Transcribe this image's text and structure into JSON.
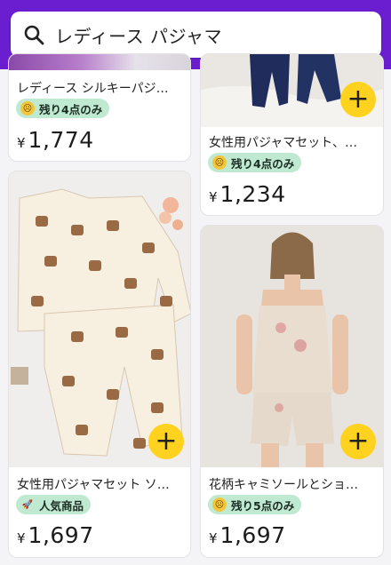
{
  "search": {
    "query": "レディース パジャマ",
    "icon": "search-icon"
  },
  "products": [
    {
      "title": "レディース シルキーパジ…",
      "badge": "残り4点のみ",
      "badge_icon": "face-icon",
      "currency": "¥",
      "price": "1,774"
    },
    {
      "title": "女性用パジャマセット、…",
      "badge": "残り4点のみ",
      "badge_icon": "face-icon",
      "currency": "¥",
      "price": "1,234"
    },
    {
      "title": "女性用パジャマセット ソ…",
      "badge": "人気商品",
      "badge_icon": "rocket-icon",
      "currency": "¥",
      "price": "1,697"
    },
    {
      "title": "花柄キャミソールとショ…",
      "badge": "残り5点のみ",
      "badge_icon": "face-icon",
      "currency": "¥",
      "price": "1,697"
    }
  ],
  "colors": {
    "header": "#6a1ed0",
    "add_button": "#ffd21f",
    "badge_bg": "#bfe9d1"
  }
}
